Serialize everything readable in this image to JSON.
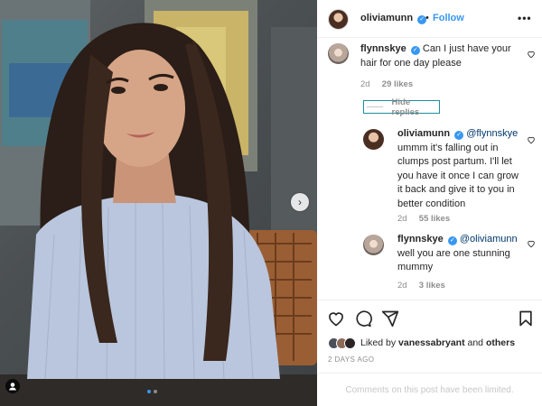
{
  "header": {
    "username": "oliviamunn",
    "verified_mark": "✓",
    "separator": "•",
    "follow_label": "Follow",
    "more_label": "•••"
  },
  "comments": [
    {
      "username": "flynnskye",
      "text": "Can I just have your hair for one day please",
      "age": "2d",
      "likes": "29 likes"
    }
  ],
  "hide_replies_label": "Hide replies",
  "replies": [
    {
      "username": "oliviamunn",
      "mention": "@flynnskye",
      "text": "ummm it's falling out in clumps post partum. I'll let you have it once I can grow it back and give it to you in better condition",
      "age": "2d",
      "likes": "55 likes"
    },
    {
      "username": "flynnskye",
      "mention": "@oliviamunn",
      "text": "well you are one stunning mummy",
      "age": "2d",
      "likes": "3 likes"
    }
  ],
  "footer": {
    "liked_prefix": "Liked by",
    "liked_user": "vanessabryant",
    "liked_and": "and",
    "liked_others": "others",
    "date": "2 DAYS AGO",
    "limited_text": "Comments on this post have been limited."
  },
  "media": {
    "next_arrow": "›",
    "slide_count": 2,
    "active_slide": 1
  },
  "colors": {
    "accent": "#3897f0",
    "link_dark": "#00376b",
    "muted": "#8e8e8e"
  },
  "icons": [
    "like-icon",
    "comment-icon",
    "share-icon",
    "save-icon",
    "heart-icon",
    "tag-user-icon",
    "next-arrow-icon",
    "verified-badge-icon",
    "more-options-icon"
  ]
}
